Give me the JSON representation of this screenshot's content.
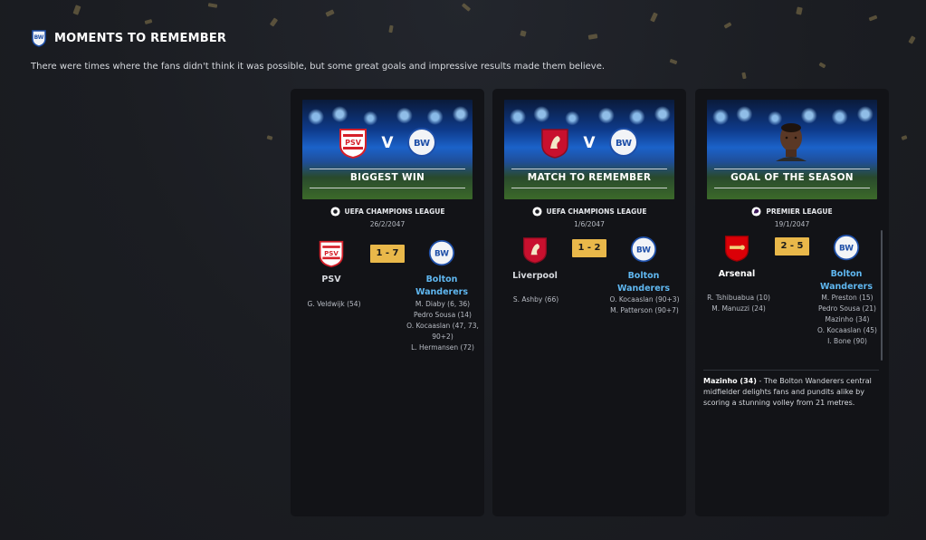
{
  "header": {
    "title": "MOMENTS TO REMEMBER",
    "subtitle": "There were times where the fans didn't think it was possible, but some great goals and impressive results made them believe."
  },
  "colors": {
    "score_badge": "#e9b84a",
    "away_name": "#5fb7f0",
    "card_bg": "#121317"
  },
  "cards": [
    {
      "banner_label": "BIGGEST WIN",
      "vs": "V",
      "competition": "UEFA CHAMPIONS LEAGUE",
      "competition_icon": "champions-league-icon",
      "date": "26/2/2047",
      "home": {
        "name": "PSV",
        "crest": "psv-crest-icon"
      },
      "away": {
        "name": "Bolton Wanderers",
        "crest": "bolton-crest-icon"
      },
      "score": "1 - 7",
      "home_scorers": [
        "G. Veldwijk (54)"
      ],
      "away_scorers": [
        "M. Diaby (6, 36)",
        "Pedro Sousa (14)",
        "O. Kocaaslan (47, 73,",
        "90+2)",
        "L. Hermansen (72)"
      ]
    },
    {
      "banner_label": "MATCH TO REMEMBER",
      "vs": "V",
      "competition": "UEFA CHAMPIONS LEAGUE",
      "competition_icon": "champions-league-icon",
      "date": "1/6/2047",
      "home": {
        "name": "Liverpool",
        "crest": "liverpool-crest-icon"
      },
      "away": {
        "name": "Bolton Wanderers",
        "crest": "bolton-crest-icon"
      },
      "score": "1 - 2",
      "home_scorers": [
        "S. Ashby (66)"
      ],
      "away_scorers": [
        "O. Kocaaslan (90+3)",
        "M. Patterson (90+7)"
      ]
    },
    {
      "banner_label": "GOAL OF THE SEASON",
      "competition": "PREMIER LEAGUE",
      "competition_icon": "premier-league-icon",
      "date": "19/1/2047",
      "home": {
        "name": "Arsenal",
        "crest": "arsenal-crest-icon"
      },
      "away": {
        "name": "Bolton Wanderers",
        "crest": "bolton-crest-icon"
      },
      "score": "2 - 5",
      "home_scorers": [
        "R. Tshibuabua (10)",
        "M. Manuzzi (24)"
      ],
      "away_scorers": [
        "M. Preston (15)",
        "Pedro Sousa (21)",
        "Mazinho (34)",
        "O. Kocaaslan (45)",
        "I. Bone (90)"
      ],
      "goal_scorer": "Mazinho (34)",
      "goal_description": " - The Bolton Wanderers central midfielder delights fans and pundits alike by scoring a stunning volley from 21 metres."
    }
  ]
}
